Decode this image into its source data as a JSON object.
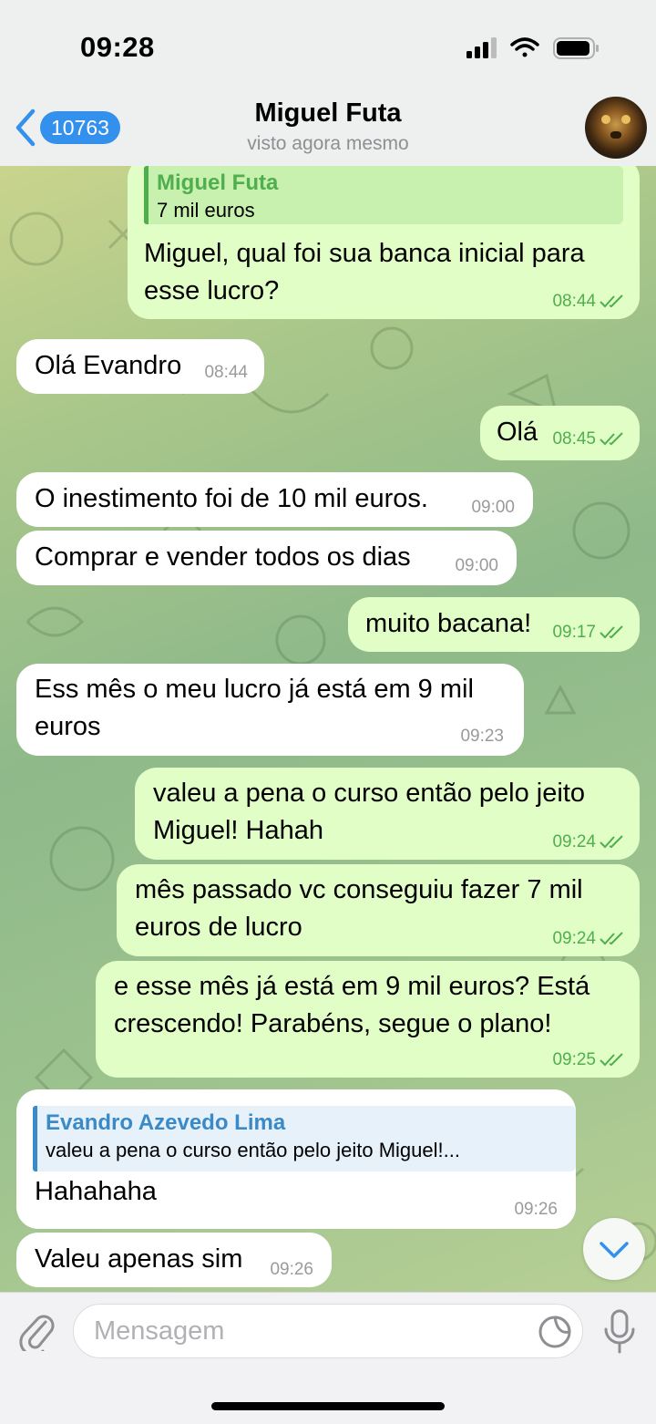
{
  "status_bar": {
    "time": "09:28"
  },
  "header": {
    "back_count": "10763",
    "name": "Miguel Futa",
    "status": "visto agora mesmo"
  },
  "messages": [
    {
      "dir": "out",
      "reply_name": "Miguel Futa",
      "reply_text": "7 mil euros",
      "text": "Miguel, qual foi sua banca inicial para esse lucro?",
      "time": "08:44",
      "read": true
    },
    {
      "dir": "in",
      "text": "Olá Evandro",
      "time": "08:44"
    },
    {
      "dir": "out",
      "text": "Olá",
      "time": "08:45",
      "read": true
    },
    {
      "dir": "in",
      "text": "O inestimento foi de 10 mil euros.",
      "time": "09:00"
    },
    {
      "dir": "in",
      "text": "Comprar e vender todos os dias",
      "time": "09:00"
    },
    {
      "dir": "out",
      "text": "muito bacana!",
      "time": "09:17",
      "read": true
    },
    {
      "dir": "in",
      "text": "Ess mês o meu lucro já está em 9 mil euros",
      "time": "09:23"
    },
    {
      "dir": "out",
      "text": "valeu a pena o curso então pelo jeito Miguel! Hahah",
      "time": "09:24",
      "read": true
    },
    {
      "dir": "out",
      "text": "mês passado vc conseguiu fazer 7 mil euros de lucro",
      "time": "09:24",
      "read": true
    },
    {
      "dir": "out",
      "text": "e esse mês já está em 9 mil euros? Está crescendo! Parabéns, segue o plano!",
      "time": "09:25",
      "read": true
    },
    {
      "dir": "in",
      "reply_name": "Evandro Azevedo Lima",
      "reply_text": "valeu a pena o curso então pelo jeito Miguel!...",
      "text": "Hahahaha",
      "time": "09:26"
    },
    {
      "dir": "in",
      "text": "Valeu apenas sim",
      "time": "09:26"
    }
  ],
  "input": {
    "placeholder": "Mensagem"
  },
  "colors": {
    "accent": "#3390ec",
    "bubble_out": "#e1fec6",
    "bubble_in": "#ffffff",
    "time_out": "#4fae4e",
    "reply_out_name": "#4fae4e",
    "reply_in_name": "#3a8ac8"
  },
  "icons": [
    "back-chevron-icon",
    "signal-icon",
    "wifi-icon",
    "battery-icon",
    "double-check-icon",
    "chevron-down-icon",
    "paperclip-icon",
    "sticker-icon",
    "microphone-icon"
  ]
}
